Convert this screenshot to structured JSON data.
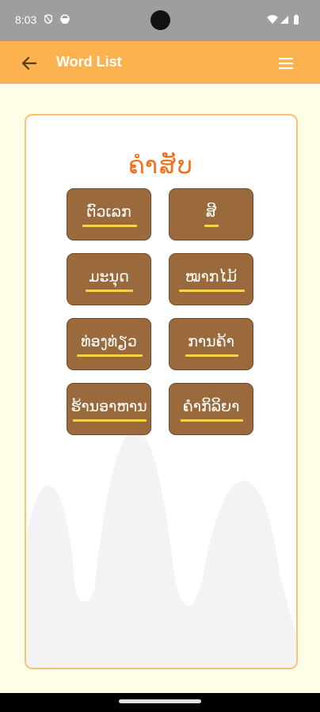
{
  "status_bar": {
    "time": "8:03",
    "icons": [
      "vpn-shield-icon",
      "sync-icon",
      "wifi-icon",
      "signal-icon",
      "battery-icon"
    ]
  },
  "app_bar": {
    "title": "Word List",
    "back_icon": "arrow-back-icon",
    "menu_icon": "hamburger-menu-icon"
  },
  "card": {
    "heading": "ຄຳສັບ",
    "words": [
      {
        "label": "ຕົວເລກ"
      },
      {
        "label": "ສີ"
      },
      {
        "label": "ມະນຸດ"
      },
      {
        "label": "ໝາກໄມ້"
      },
      {
        "label": "ທ່ອງທ່ຽວ"
      },
      {
        "label": "ການຄ້າ"
      },
      {
        "label": "ຮ້ານອາຫານ"
      },
      {
        "label": "ຄຳກິລິຍາ"
      }
    ]
  },
  "colors": {
    "app_bar": "#fdb250",
    "background": "#fffde7",
    "heading": "#f2711c",
    "button": "#9a6a3c",
    "underline": "#f7d34a",
    "card_border": "#fcc46a"
  }
}
